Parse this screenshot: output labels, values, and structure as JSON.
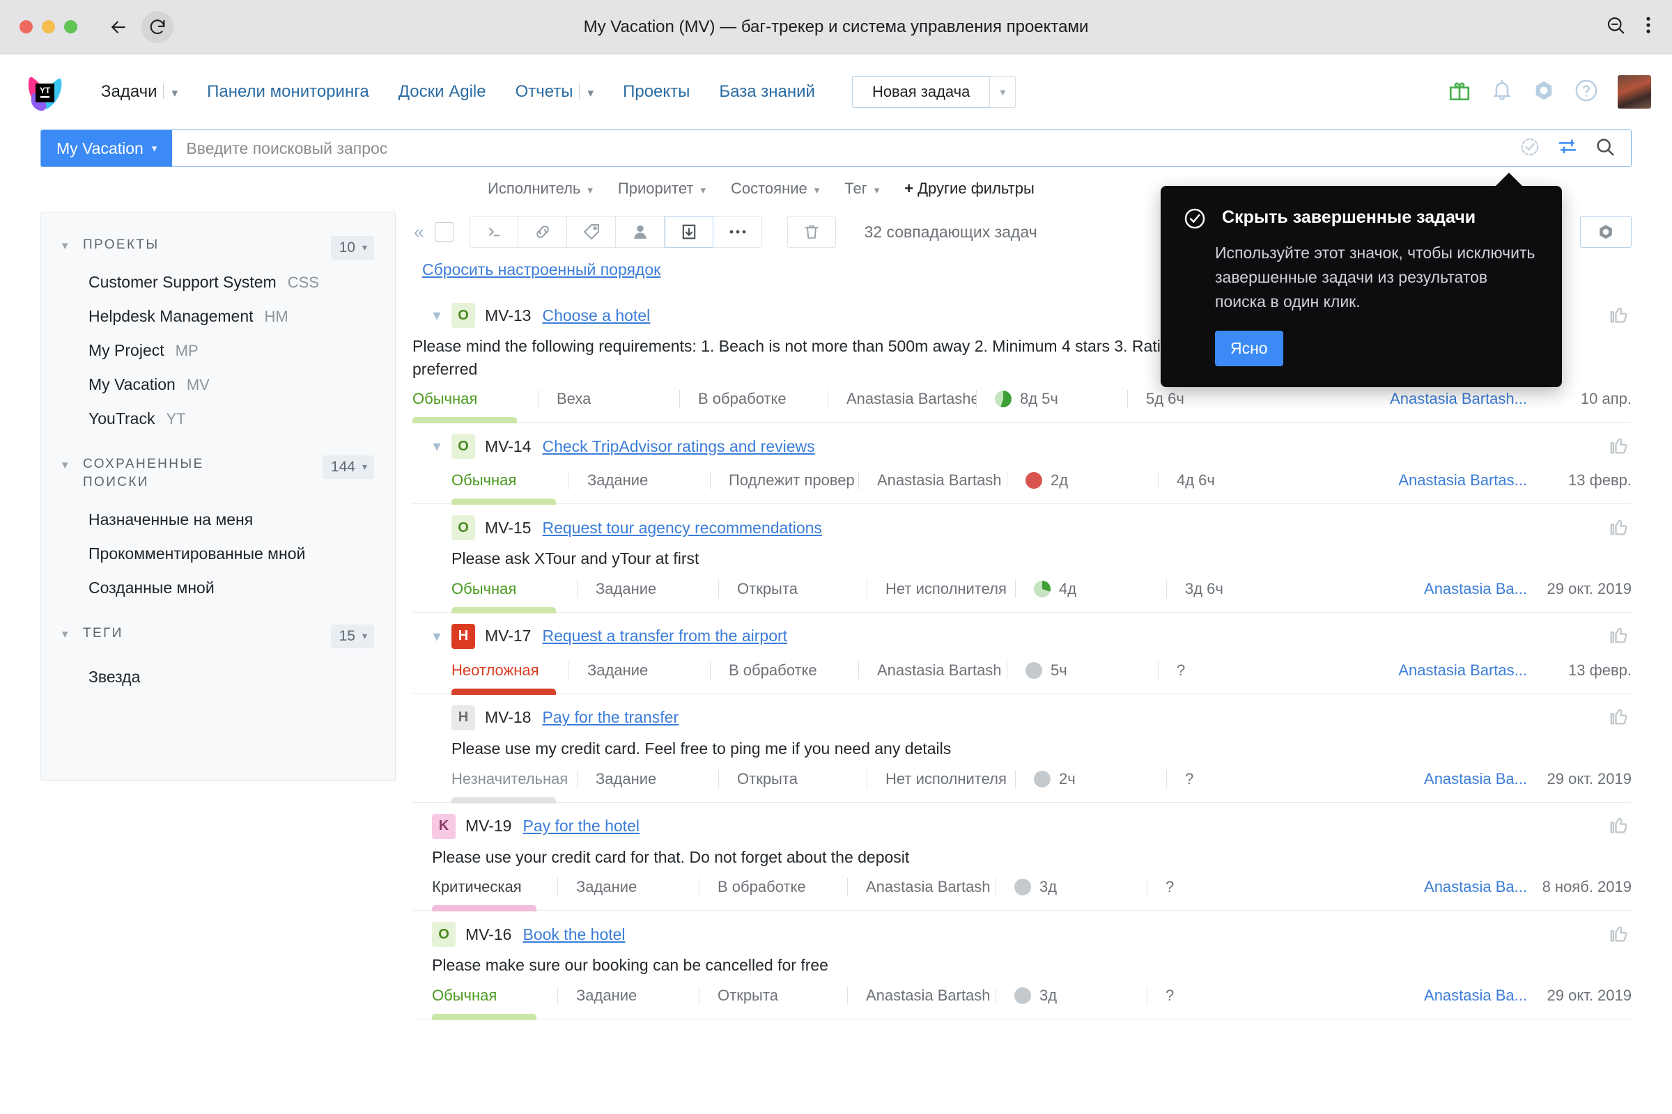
{
  "window": {
    "title": "My Vacation (MV) — баг-трекер и система управления проектами",
    "back_icon": "back-arrow-icon",
    "reload_icon": "reload-icon",
    "zoom_out_icon": "zoom-out-icon",
    "menu_icon": "kebab-menu-icon"
  },
  "header": {
    "logo": "youtrack-logo",
    "nav": [
      {
        "label": "Задачи",
        "has_caret": true,
        "style": "dark"
      },
      {
        "label": "Панели мониторинга",
        "has_caret": false,
        "style": "link"
      },
      {
        "label": "Доски Agile",
        "has_caret": false,
        "style": "link"
      },
      {
        "label": "Отчеты",
        "has_caret": true,
        "style": "link"
      },
      {
        "label": "Проекты",
        "has_caret": false,
        "style": "link"
      },
      {
        "label": "База знаний",
        "has_caret": false,
        "style": "link"
      }
    ],
    "new_task_label": "Новая задача",
    "icons": [
      "gift-icon",
      "bell-icon",
      "hexagon-icon",
      "help-icon",
      "avatar"
    ]
  },
  "search": {
    "context_label": "My Vacation",
    "placeholder": "Введите поисковый запрос",
    "value": "",
    "icons": [
      "hide-resolved-icon",
      "filter-settings-icon",
      "search-icon"
    ]
  },
  "filters": [
    {
      "label": "Исполнитель",
      "caret": true
    },
    {
      "label": "Приоритет",
      "caret": true
    },
    {
      "label": "Состояние",
      "caret": true
    },
    {
      "label": "Тег",
      "caret": true
    },
    {
      "label": "Другие фильтры",
      "caret": false,
      "plus": "+"
    }
  ],
  "sidebar": {
    "sections": [
      {
        "title": "Проекты",
        "count": "10",
        "items": [
          {
            "name": "Customer Support System",
            "abbr": "CSS"
          },
          {
            "name": "Helpdesk Management",
            "abbr": "HM"
          },
          {
            "name": "My Project",
            "abbr": "MP"
          },
          {
            "name": "My Vacation",
            "abbr": "MV"
          },
          {
            "name": "YouTrack",
            "abbr": "YT"
          }
        ]
      },
      {
        "title": "Сохраненные поиски",
        "count": "144",
        "items": [
          {
            "name": "Назначенные на меня",
            "abbr": ""
          },
          {
            "name": "Прокомментированные мной",
            "abbr": ""
          },
          {
            "name": "Созданные мной",
            "abbr": ""
          }
        ]
      },
      {
        "title": "Теги",
        "count": "15",
        "items": [
          {
            "name": "Звезда",
            "abbr": ""
          }
        ]
      }
    ]
  },
  "toolbar": {
    "collapse_icon": "collapse-left-icon",
    "buttons": [
      {
        "icon": "command-icon"
      },
      {
        "icon": "link-icon"
      },
      {
        "icon": "tag-icon"
      },
      {
        "icon": "user-icon"
      },
      {
        "icon": "move-to-icon",
        "highlighted": true
      },
      {
        "icon": "ellipsis-icon"
      }
    ],
    "trash_icon": "trash-icon",
    "match_count": "32 совпадающих задач",
    "settings_icon": "hexagon-gear-icon",
    "reset_order_label": "Сбросить настроенный порядок"
  },
  "tooltip": {
    "icon": "check-circle-icon",
    "title": "Скрыть завершенные задачи",
    "body": "Используйте этот значок, чтобы исключить завершенные задачи из результатов поиска в один клик.",
    "button": "Ясно"
  },
  "issues": [
    {
      "id": "MV-13",
      "title": "Choose a hotel",
      "badge": "O",
      "badge_type": "normal",
      "expandable": true,
      "nested": false,
      "description": "Please mind the following requirements: 1. Beach is not more than 500m away 2. Minimum 4 stars 3. Rating should be 8.0 and higher 4. Half board is preferred",
      "priority": "Обычная",
      "priority_class": "normal",
      "type": "Веха",
      "state": "В обработке",
      "assignee": "Anastasia Bartashe",
      "estimate": "8д 5ч",
      "estimate_pie": "green",
      "spent": "5д 6ч",
      "reporter": "Anastasia Bartash...",
      "date": "10 апр."
    },
    {
      "id": "MV-14",
      "title": "Check TripAdvisor ratings and reviews",
      "badge": "O",
      "badge_type": "normal",
      "expandable": true,
      "nested": false,
      "description": "",
      "priority": "Обычная",
      "priority_class": "normal",
      "type": "Задание",
      "state": "Подлежит провер",
      "assignee": "Anastasia Bartash",
      "estimate": "2д",
      "estimate_pie": "red",
      "spent": "4д 6ч",
      "reporter": "Anastasia Bartas...",
      "date": "13 февр."
    },
    {
      "id": "MV-15",
      "title": "Request tour agency recommendations",
      "badge": "O",
      "badge_type": "normal",
      "expandable": false,
      "nested": true,
      "description": "Please ask XTour and yTour at first",
      "priority": "Обычная",
      "priority_class": "normal",
      "type": "Задание",
      "state": "Открыта",
      "assignee": "Нет исполнителя",
      "estimate": "4д",
      "estimate_pie": "green2",
      "spent": "3д 6ч",
      "reporter": "Anastasia Ba...",
      "date": "29 окт. 2019"
    },
    {
      "id": "MV-17",
      "title": "Request a transfer from the airport",
      "badge": "H",
      "badge_type": "urgent",
      "expandable": true,
      "nested": false,
      "description": "",
      "priority": "Неотложная",
      "priority_class": "urgent",
      "type": "Задание",
      "state": "В обработке",
      "assignee": "Anastasia Bartash",
      "estimate": "5ч",
      "estimate_pie": "grey",
      "spent": "?",
      "reporter": "Anastasia Bartas...",
      "date": "13 февр."
    },
    {
      "id": "MV-18",
      "title": "Pay for the transfer",
      "badge": "H",
      "badge_type": "minor",
      "expandable": false,
      "nested": true,
      "description": "Please use my credit card. Feel free to ping me if you need any details",
      "priority": "Незначительная",
      "priority_class": "minor",
      "type": "Задание",
      "state": "Открыта",
      "assignee": "Нет исполнителя",
      "estimate": "2ч",
      "estimate_pie": "grey",
      "spent": "?",
      "reporter": "Anastasia Ba...",
      "date": "29 окт. 2019"
    },
    {
      "id": "MV-19",
      "title": "Pay for the hotel",
      "badge": "K",
      "badge_type": "critical",
      "expandable": false,
      "nested": true,
      "description": "Please use your credit card for that. Do not forget about the deposit",
      "priority": "Критическая",
      "priority_class": "critical",
      "type": "Задание",
      "state": "В обработке",
      "assignee": "Anastasia Bartash",
      "estimate": "3д",
      "estimate_pie": "grey",
      "spent": "?",
      "reporter": "Anastasia Ba...",
      "date": "8 нояб. 2019"
    },
    {
      "id": "MV-16",
      "title": "Book the hotel",
      "badge": "O",
      "badge_type": "normal",
      "expandable": false,
      "nested": true,
      "description": "Please make sure our booking can be cancelled for free",
      "priority": "Обычная",
      "priority_class": "normal",
      "type": "Задание",
      "state": "Открыта",
      "assignee": "Anastasia Bartash",
      "estimate": "3д",
      "estimate_pie": "grey",
      "spent": "?",
      "reporter": "Anastasia Ba...",
      "date": "29 окт. 2019"
    }
  ],
  "colors": {
    "accent": "#3b8af5",
    "link": "#3b7dd8",
    "normal": "#4b9a1f",
    "urgent": "#db3b21",
    "critical": "#f7c9e2",
    "tooltip_bg": "#0d0d0f"
  }
}
